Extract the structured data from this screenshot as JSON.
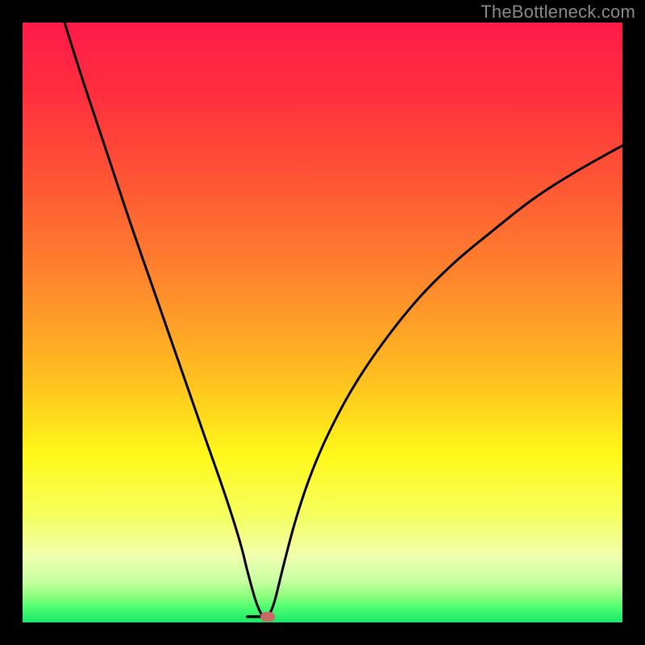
{
  "watermark": "TheBottleneck.com",
  "colors": {
    "gradient_stops": [
      {
        "offset": 0.0,
        "color": "#ff1a49"
      },
      {
        "offset": 0.12,
        "color": "#ff2f3e"
      },
      {
        "offset": 0.28,
        "color": "#ff5a33"
      },
      {
        "offset": 0.44,
        "color": "#ff8a2d"
      },
      {
        "offset": 0.6,
        "color": "#ffc21f"
      },
      {
        "offset": 0.72,
        "color": "#fff81a"
      },
      {
        "offset": 0.82,
        "color": "#f6ff5d"
      },
      {
        "offset": 0.89,
        "color": "#f0ffae"
      },
      {
        "offset": 0.93,
        "color": "#c9ffa3"
      },
      {
        "offset": 0.955,
        "color": "#90ff7f"
      },
      {
        "offset": 0.975,
        "color": "#4dfd6e"
      },
      {
        "offset": 1.0,
        "color": "#17e86a"
      }
    ],
    "curve": "#000000",
    "marker": "#c86a63",
    "background": "#000000"
  },
  "chart_data": {
    "type": "line",
    "title": "",
    "xlabel": "",
    "ylabel": "",
    "xlim": [
      0,
      100
    ],
    "ylim": [
      0,
      100
    ],
    "grid": false,
    "legend": false,
    "series": [
      {
        "name": "curve",
        "x": [
          7,
          10,
          14,
          18,
          22,
          26,
          30,
          33,
          35,
          36.5,
          37.5,
          38.8,
          39.7,
          40.3,
          41,
          42,
          43.5,
          45.5,
          48,
          51,
          55,
          60,
          66,
          72,
          78,
          85,
          92,
          100
        ],
        "y": [
          100,
          90.5,
          78.5,
          66.5,
          55,
          43.5,
          32,
          23.5,
          17.5,
          12.5,
          8.5,
          3.8,
          1.6,
          1.0,
          1.2,
          3.5,
          9.5,
          17,
          24.5,
          31.5,
          39,
          46.5,
          54,
          60,
          65,
          70.5,
          75,
          79.5
        ]
      }
    ],
    "marker": {
      "x": 40.8,
      "y": 0.9
    },
    "flat_segment": {
      "x_start": 37.5,
      "x_end": 40.3,
      "y": 0.95
    }
  }
}
